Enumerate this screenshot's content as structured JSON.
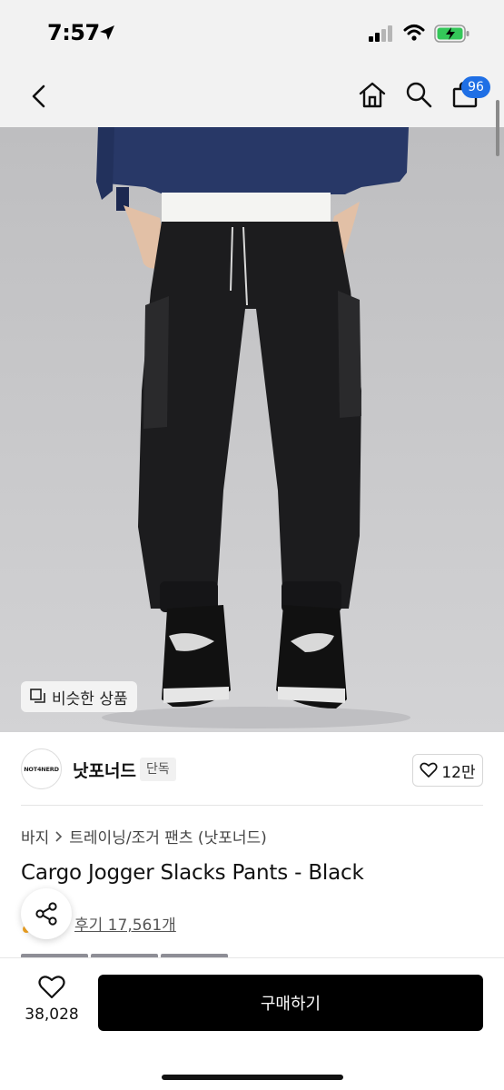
{
  "status_bar": {
    "time": "7:57"
  },
  "nav": {
    "cart_count": "96"
  },
  "hero": {
    "similar_label": "비슷한 상품"
  },
  "brand": {
    "logo_text": "NOT4NERD",
    "name": "낫포너드",
    "exclusive_label": "단독",
    "like_count": "12만"
  },
  "breadcrumb": {
    "category": "바지",
    "subcategory": "트레이닝/조거 팬츠 (낫포너드)"
  },
  "product": {
    "title": "Cargo Jogger Slacks Pants - Black",
    "reviews": "후기 17,561개"
  },
  "bottom": {
    "like_count": "38,028",
    "buy_label": "구매하기"
  },
  "colors": {
    "accent_badge": "#1f6fe5",
    "buy_button": "#000000",
    "star": "#f5a623"
  }
}
